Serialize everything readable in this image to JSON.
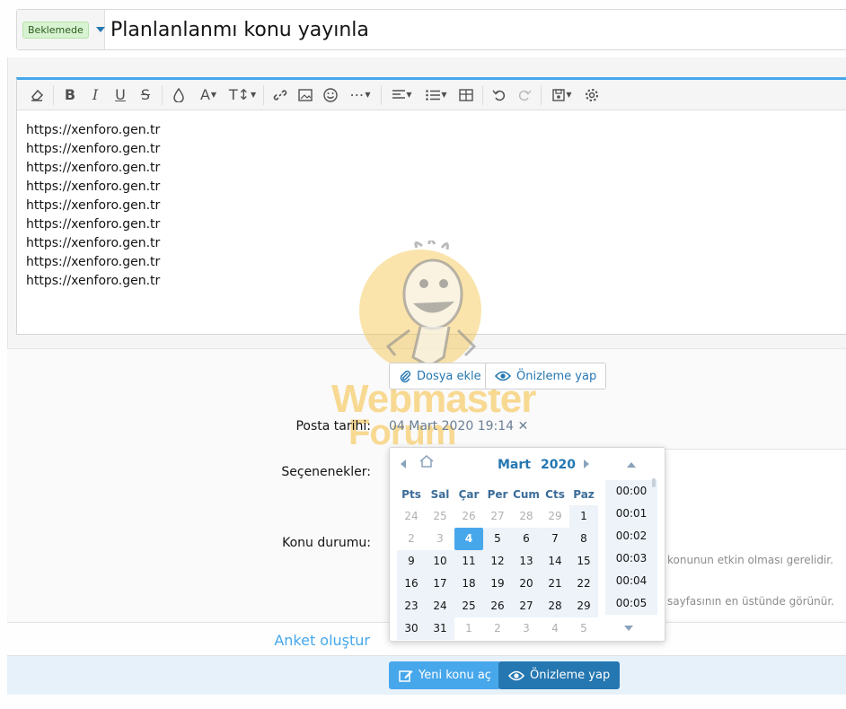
{
  "title_row": {
    "prefix_badge": "Beklemede",
    "title_value": "Planlanlanmı konu yayınla"
  },
  "editor": {
    "toolbar": [
      {
        "name": "eraser-icon"
      },
      {
        "name": "bold-icon",
        "glyph": "B"
      },
      {
        "name": "italic-icon",
        "glyph": "I"
      },
      {
        "name": "underline-icon",
        "glyph": "U"
      },
      {
        "name": "strikethrough-icon",
        "glyph": "S"
      },
      {
        "name": "text-color-icon"
      },
      {
        "name": "font-family-icon",
        "glyph": "A"
      },
      {
        "name": "font-size-icon",
        "glyph": "T↕"
      },
      {
        "name": "link-icon"
      },
      {
        "name": "image-icon"
      },
      {
        "name": "smiley-icon"
      },
      {
        "name": "more-icon"
      },
      {
        "name": "align-icon"
      },
      {
        "name": "list-icon"
      },
      {
        "name": "table-icon"
      },
      {
        "name": "undo-icon"
      },
      {
        "name": "redo-icon"
      },
      {
        "name": "draft-icon"
      },
      {
        "name": "settings-icon"
      }
    ],
    "lines": [
      "https://xenforo.gen.tr",
      "https://xenforo.gen.tr",
      "https://xenforo.gen.tr",
      "https://xenforo.gen.tr",
      "https://xenforo.gen.tr",
      "https://xenforo.gen.tr",
      "https://xenforo.gen.tr",
      "https://xenforo.gen.tr",
      "https://xenforo.gen.tr"
    ]
  },
  "attach_button": "Dosya ekle",
  "preview_button_small": "Önizleme yap",
  "labels": {
    "post_date": "Posta tarihi:",
    "options": "Seçenenekler:",
    "thread_status": "Konu durumu:"
  },
  "post_date_value": "04 Mart 2020 19:14",
  "hints": {
    "open_hint": "konunun etkin olması gerelidir.",
    "sticky_hint": "sayfasının en üstünde görünür."
  },
  "watermark": {
    "line1": "Webmaster",
    "line2": "Forum"
  },
  "poll_link": "Anket oluştur",
  "footer": {
    "submit": "Yeni konu aç",
    "preview": "Önizleme yap"
  },
  "datepicker": {
    "month": "Mart",
    "year": "2020",
    "weekdays": [
      "Pts",
      "Sal",
      "Çar",
      "Per",
      "Cum",
      "Cts",
      "Paz"
    ],
    "weeks": [
      [
        "24",
        "25",
        "26",
        "27",
        "28",
        "29",
        "1"
      ],
      [
        "2",
        "3",
        "4",
        "5",
        "6",
        "7",
        "8"
      ],
      [
        "9",
        "10",
        "11",
        "12",
        "13",
        "14",
        "15"
      ],
      [
        "16",
        "17",
        "18",
        "19",
        "20",
        "21",
        "22"
      ],
      [
        "23",
        "24",
        "25",
        "26",
        "27",
        "28",
        "29"
      ],
      [
        "30",
        "31",
        "1",
        "2",
        "3",
        "4",
        "5"
      ]
    ],
    "selected_day": "4",
    "times": [
      "00:00",
      "00:01",
      "00:02",
      "00:03",
      "00:04",
      "00:05"
    ]
  },
  "colors": {
    "accent": "#47a7eb",
    "link": "#2577b1",
    "primary_button": "#47a7eb",
    "secondary_button": "#2577b1",
    "badge_bg": "#d8f3d1"
  }
}
